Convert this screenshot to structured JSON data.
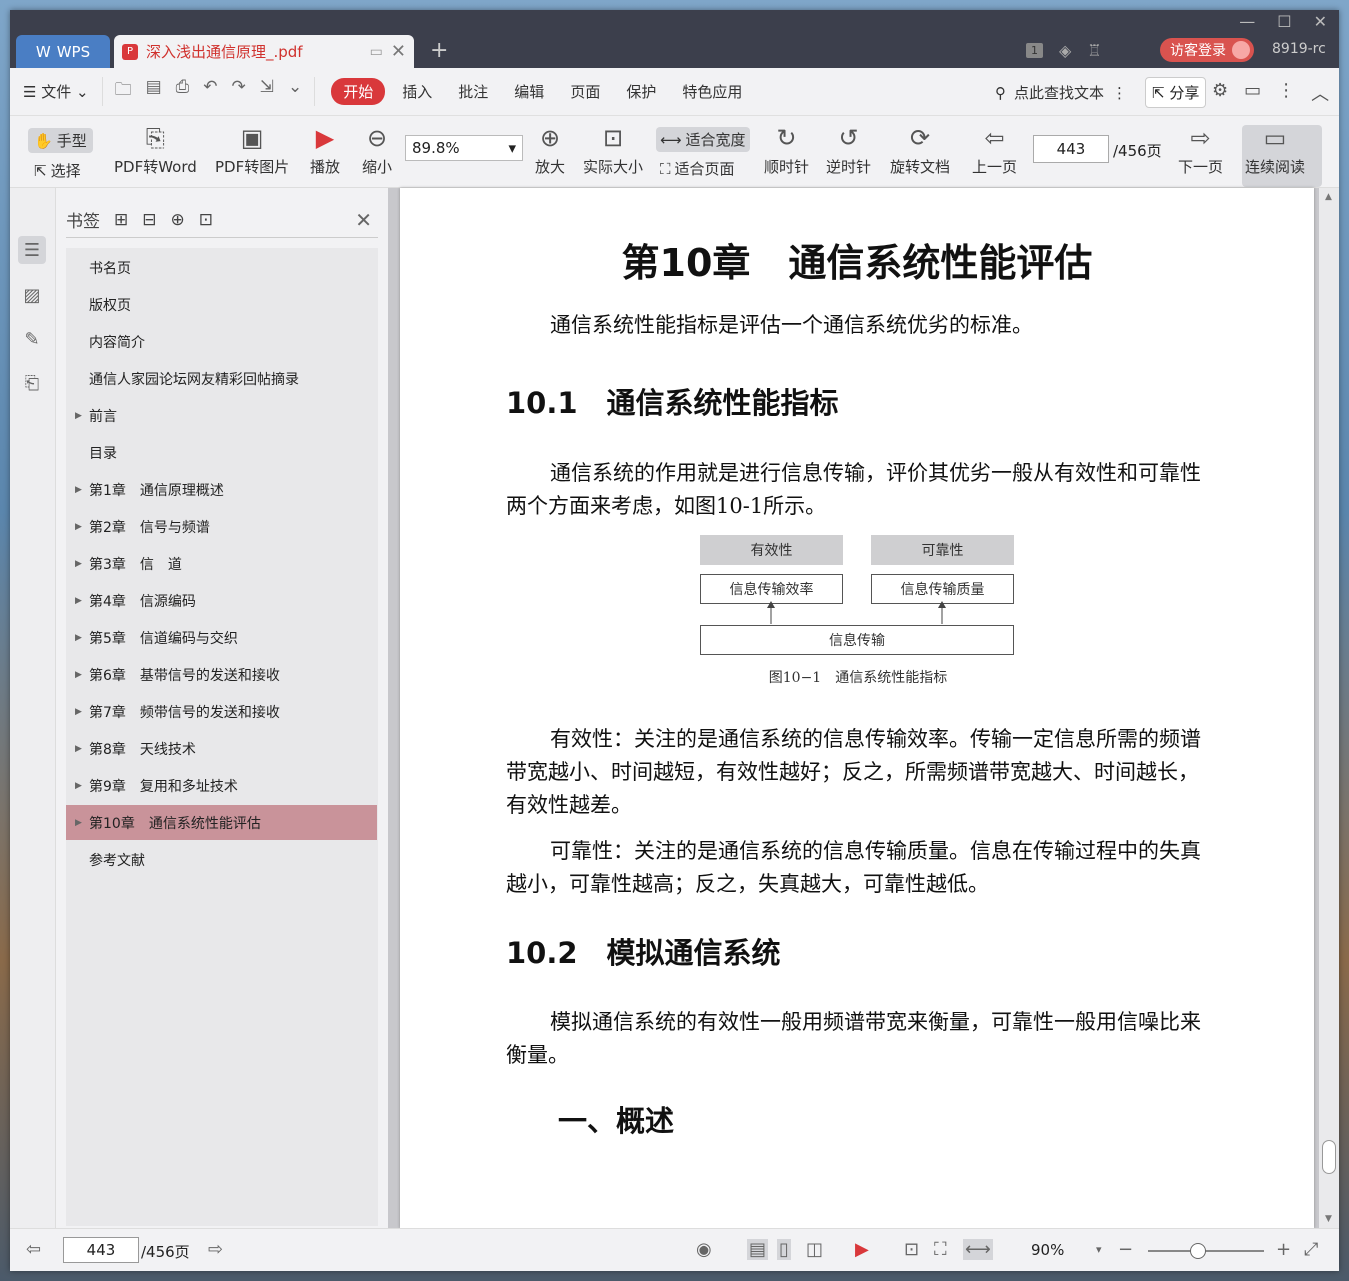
{
  "titlebar": {
    "app_tab": "WPS",
    "doc_tab": "深入浅出通信原理_.pdf",
    "page_badge": "1",
    "login": "访客登录",
    "user": "8919-rc"
  },
  "menu": {
    "file": "文件",
    "items": [
      "开始",
      "插入",
      "批注",
      "编辑",
      "页面",
      "保护",
      "特色应用"
    ],
    "search": "点此查找文本",
    "share": "分享"
  },
  "toolbar": {
    "hand": "手型",
    "select": "选择",
    "pdf2word": "PDF转Word",
    "pdf2img": "PDF转图片",
    "play": "播放",
    "zoom_out": "缩小",
    "zoom_value": "89.8%",
    "zoom_in": "放大",
    "actual": "实际大小",
    "fit_width": "适合宽度",
    "fit_page": "适合页面",
    "cw": "顺时针",
    "ccw": "逆时针",
    "rotate": "旋转文档",
    "prev": "上一页",
    "page": "443",
    "total": "/456页",
    "next": "下一页",
    "continuous": "连续阅读"
  },
  "bookmarks": {
    "title": "书签",
    "items": [
      {
        "label": "书名页",
        "arrow": false
      },
      {
        "label": "版权页",
        "arrow": false
      },
      {
        "label": "内容简介",
        "arrow": false
      },
      {
        "label": "通信人家园论坛网友精彩回帖摘录",
        "arrow": false
      },
      {
        "label": "前言",
        "arrow": true
      },
      {
        "label": "目录",
        "arrow": false
      },
      {
        "label": "第1章　通信原理概述",
        "arrow": true
      },
      {
        "label": "第2章　信号与频谱",
        "arrow": true
      },
      {
        "label": "第3章　信　道",
        "arrow": true
      },
      {
        "label": "第4章　信源编码",
        "arrow": true
      },
      {
        "label": "第5章　信道编码与交织",
        "arrow": true
      },
      {
        "label": "第6章　基带信号的发送和接收",
        "arrow": true
      },
      {
        "label": "第7章　频带信号的发送和接收",
        "arrow": true
      },
      {
        "label": "第8章　天线技术",
        "arrow": true
      },
      {
        "label": "第9章　复用和多址技术",
        "arrow": true
      },
      {
        "label": "第10章　通信系统性能评估",
        "arrow": true,
        "selected": true
      },
      {
        "label": "参考文献",
        "arrow": false
      }
    ]
  },
  "doc": {
    "chapter_title": "第10章　通信系统性能评估",
    "intro": "通信系统性能指标是评估一个通信系统优劣的标准。",
    "h_10_1": "10.1　通信系统性能指标",
    "p1": "通信系统的作用就是进行信息传输，评价其优劣一般从有效性和可靠性两个方面来考虑，如图10-1所示。",
    "figure": {
      "top_left": "有效性",
      "top_right": "可靠性",
      "mid_left": "信息传输效率",
      "mid_right": "信息传输质量",
      "bottom": "信息传输",
      "caption": "图10−1　通信系统性能指标"
    },
    "p2": "有效性：关注的是通信系统的信息传输效率。传输一定信息所需的频谱带宽越小、时间越短，有效性越好；反之，所需频谱带宽越大、时间越长，有效性越差。",
    "p3": "可靠性：关注的是通信系统的信息传输质量。信息在传输过程中的失真越小，可靠性越高；反之，失真越大，可靠性越低。",
    "h_10_2": "10.2　模拟通信系统",
    "p4": "模拟通信系统的有效性一般用频谱带宽来衡量，可靠性一般用信噪比来衡量。",
    "h_sub": "一、概述"
  },
  "status": {
    "page": "443",
    "total": "/456页",
    "zoom": "90%"
  },
  "colors": {
    "accent": "#d9383b",
    "selected_bookmark": "#c9939a",
    "titlebar": "#3c3f4c"
  }
}
